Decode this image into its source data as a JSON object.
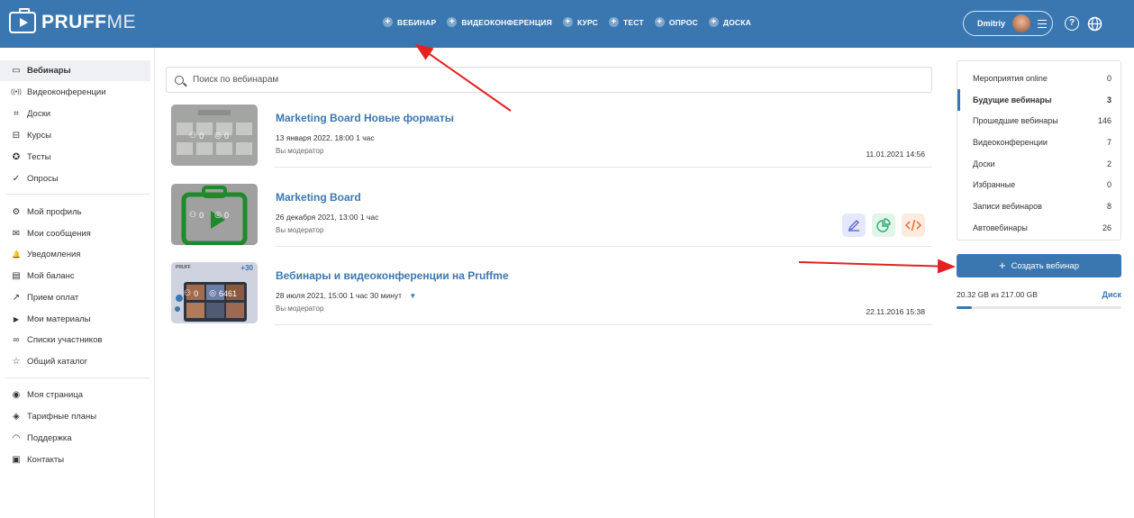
{
  "header": {
    "logo_main": "PRUFF",
    "logo_thin": "ME",
    "nav": [
      "ВЕБИНАР",
      "ВИДЕОКОНФЕРЕНЦИЯ",
      "КУРС",
      "ТЕСТ",
      "ОПРОС",
      "ДОСКА"
    ],
    "user_name": "Dmitriy",
    "help_glyph": "?"
  },
  "sidebar": {
    "items": [
      {
        "label": "Вебинары",
        "icon": "webinar-camera-icon",
        "glyph": "▭"
      },
      {
        "label": "Видеоконференции",
        "icon": "broadcast-icon",
        "glyph": "((•))"
      },
      {
        "label": "Доски",
        "icon": "board-icon",
        "glyph": "⌗"
      },
      {
        "label": "Курсы",
        "icon": "course-briefcase-icon",
        "glyph": "⊟"
      },
      {
        "label": "Тесты",
        "icon": "award-icon",
        "glyph": "✪"
      },
      {
        "label": "Опросы",
        "icon": "check-circle-icon",
        "glyph": "✓"
      },
      {
        "label": "Мой профиль",
        "icon": "gear-icon",
        "glyph": "⚙"
      },
      {
        "label": "Мои сообщения",
        "icon": "message-icon",
        "glyph": "✉"
      },
      {
        "label": "Уведомления",
        "icon": "bell-icon",
        "glyph": "🔔"
      },
      {
        "label": "Мой баланс",
        "icon": "wallet-icon",
        "glyph": "▤"
      },
      {
        "label": "Прием оплат",
        "icon": "payment-icon",
        "glyph": "↗"
      },
      {
        "label": "Мои материалы",
        "icon": "play-circle-icon",
        "glyph": "▶"
      },
      {
        "label": "Списки участников",
        "icon": "group-icon",
        "glyph": "∞"
      },
      {
        "label": "Общий каталог",
        "icon": "star-icon",
        "glyph": "☆"
      },
      {
        "label": "Моя страница",
        "icon": "user-circle-icon",
        "glyph": "◉"
      },
      {
        "label": "Тарифные планы",
        "icon": "diamond-icon",
        "glyph": "◈"
      },
      {
        "label": "Поддержка",
        "icon": "headset-icon",
        "glyph": "◠"
      },
      {
        "label": "Контакты",
        "icon": "contacts-icon",
        "glyph": "▣"
      }
    ]
  },
  "search": {
    "placeholder": "Поиск по вебинарам"
  },
  "webinars": [
    {
      "title": "Marketing Board Новые форматы",
      "date": "13 января 2022, 18:00   1 час",
      "role": "Вы модератор",
      "stamp": "11.01.2021 14:56",
      "participants": "0",
      "views": "0"
    },
    {
      "title": "Marketing Board",
      "date": "26 декабря 2021, 13:00   1 час",
      "role": "Вы модератор",
      "stamp": "",
      "participants": "0",
      "views": "0"
    },
    {
      "title": "Вебинары и видеоконференции на Pruffme",
      "date": "28 июля 2021, 15:00   1 час 30 минут",
      "role": "Вы модератор",
      "stamp": "22.11.2016 15:38",
      "participants": "0",
      "views": "6461",
      "thumb_badge": "+30",
      "thumb_brand": "PRUFF"
    }
  ],
  "right_panel": {
    "items": [
      {
        "label": "Мероприятия online",
        "count": "0"
      },
      {
        "label": "Будущие вебинары",
        "count": "3"
      },
      {
        "label": "Прошедшие вебинары",
        "count": "146"
      },
      {
        "label": "Видеоконференции",
        "count": "7"
      },
      {
        "label": "Доски",
        "count": "2"
      },
      {
        "label": "Избранные",
        "count": "0"
      },
      {
        "label": "Записи вебинаров",
        "count": "8"
      },
      {
        "label": "Автовебинары",
        "count": "26"
      }
    ],
    "create_label": "Создать вебинар",
    "storage_text": "20.32 GB из 217.00 GB",
    "disk_label": "Диск",
    "storage_fraction": 0.094
  },
  "colors": {
    "brand": "#3a77b0",
    "annotation": "#e32222",
    "edit": "#5661d4",
    "stats": "#2eab6f",
    "embed": "#e9692c"
  }
}
